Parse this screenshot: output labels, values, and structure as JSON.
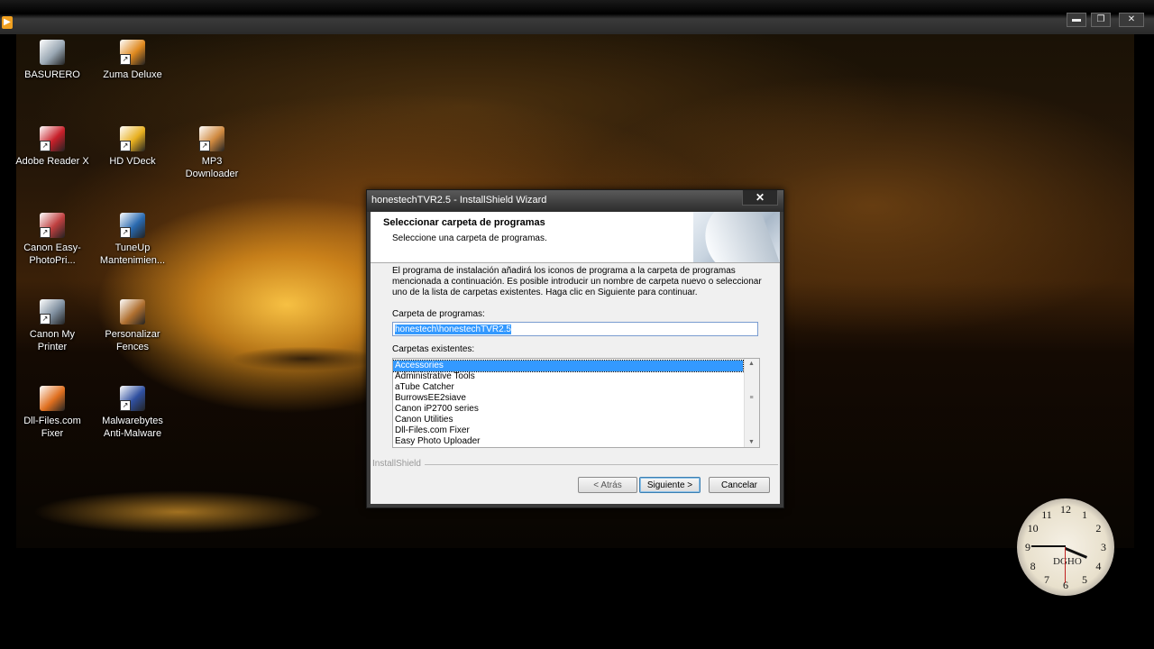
{
  "player": {
    "window_controls": [
      "▬",
      "❐",
      "✕"
    ]
  },
  "desktop_icons": [
    {
      "label": "BASURERO",
      "icon": "recycle-bin-icon",
      "color": "#9aa8b4"
    },
    {
      "label": "Zuma Deluxe",
      "icon": "zuma-icon",
      "color": "#e08a20"
    },
    {
      "label": "Adobe Reader X",
      "icon": "adobe-reader-icon",
      "color": "#c8202a"
    },
    {
      "label": "HD VDeck",
      "icon": "hd-vdeck-icon",
      "color": "#e8b020"
    },
    {
      "label": "MP3 Downloader",
      "icon": "mp3-downloader-icon",
      "color": "#d08a40"
    },
    {
      "label": "Canon Easy-PhotoPri...",
      "icon": "canon-easy-photoprint-icon",
      "color": "#c04040"
    },
    {
      "label": "TuneUp Mantenimien...",
      "icon": "tuneup-icon",
      "color": "#2a6ab0"
    },
    {
      "label": "Canon My Printer",
      "icon": "canon-my-printer-icon",
      "color": "#8090a0"
    },
    {
      "label": "Personalizar Fences",
      "icon": "fences-icon",
      "color": "#b07030"
    },
    {
      "label": "Dll-Files.com Fixer",
      "icon": "dll-files-fixer-icon",
      "color": "#e07020"
    },
    {
      "label": "Malwarebytes Anti-Malware",
      "icon": "malwarebytes-icon",
      "color": "#3050a0"
    }
  ],
  "wizard": {
    "title": "honestechTVR2.5 - InstallShield Wizard",
    "close_label": "✕",
    "header_title": "Seleccionar carpeta de programas",
    "header_subtitle": "Seleccione una carpeta de programas.",
    "instructions": "El programa de instalación añadirá los iconos de programa a la carpeta de programas mencionada a continuación.  Es posible introducir un nombre de carpeta nuevo o seleccionar uno de la lista de carpetas existentes.  Haga clic en Siguiente para continuar.",
    "program_folder_label": "Carpeta de programas:",
    "program_folder_value": "honestech\\honestechTVR2.5",
    "existing_folders_label": "Carpetas existentes:",
    "existing_folders": [
      "Accessories",
      "Administrative Tools",
      "aTube Catcher",
      "BurrowsEE2siave",
      "Canon iP2700 series",
      "Canon Utilities",
      "Dll-Files.com Fixer",
      "Easy Photo Uploader"
    ],
    "selected_folder": "Accessories",
    "brand": "InstallShield",
    "back_button": "< Atrás",
    "next_button": "Siguiente >",
    "cancel_button": "Cancelar"
  },
  "clock": {
    "brand": "DGHO",
    "time": "3:45",
    "numbers": [
      "12",
      "1",
      "2",
      "3",
      "4",
      "5",
      "6",
      "7",
      "8",
      "9",
      "10",
      "11"
    ]
  }
}
